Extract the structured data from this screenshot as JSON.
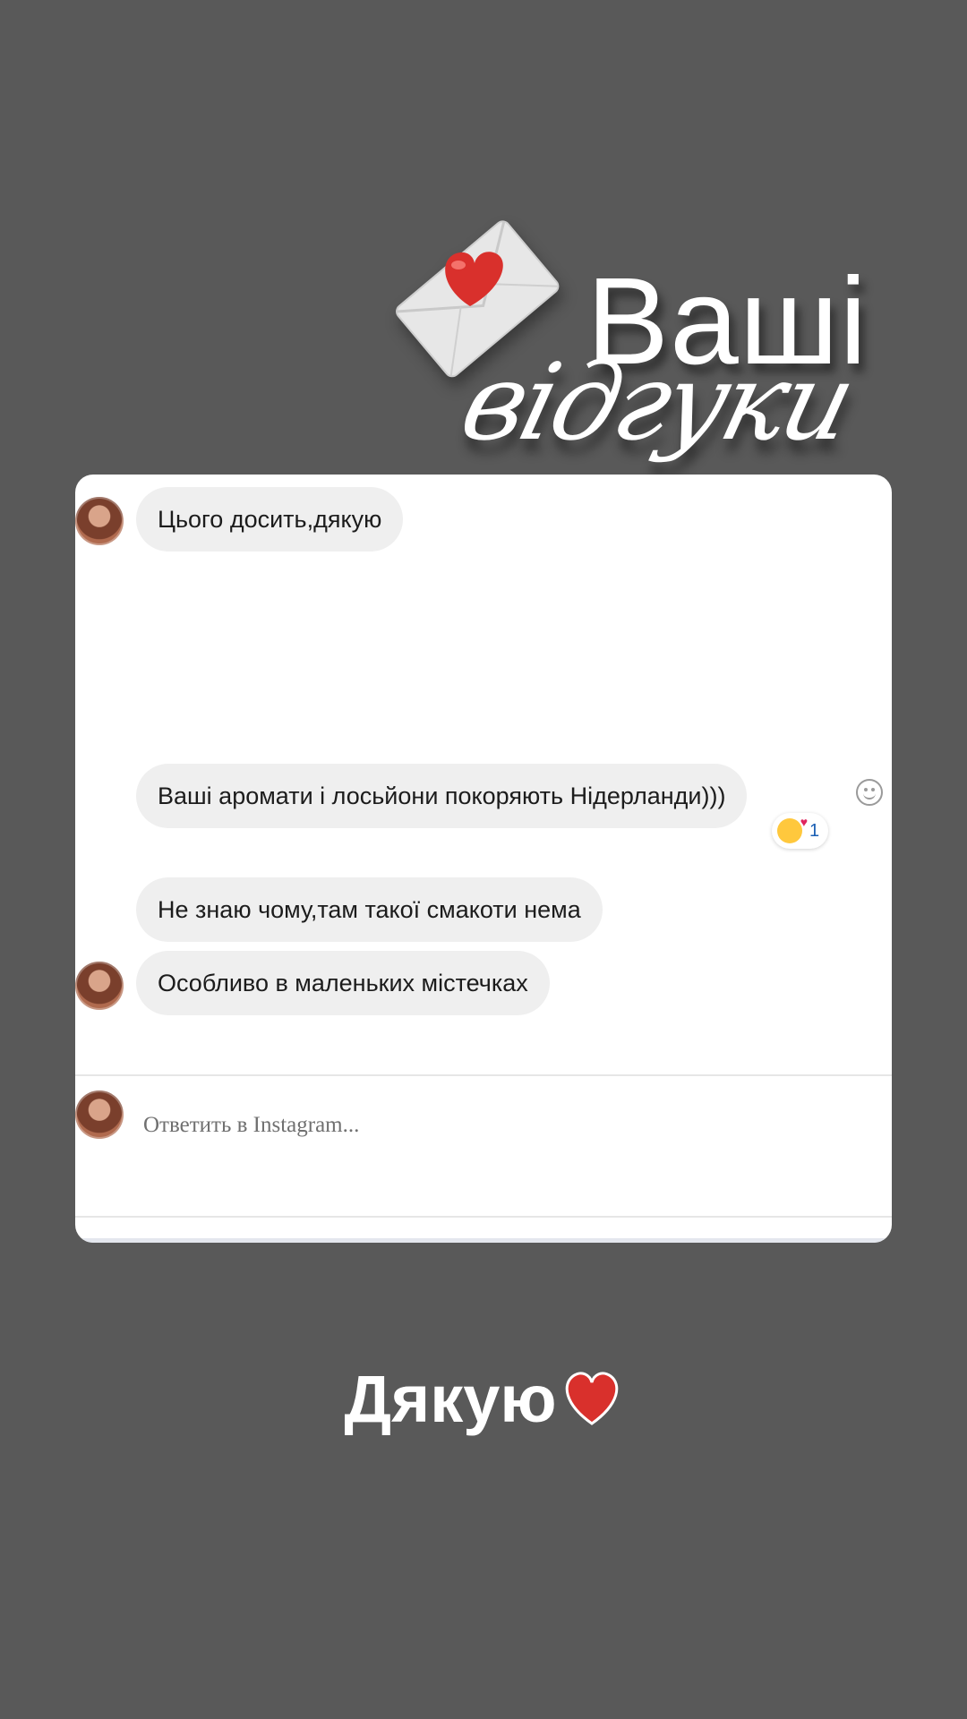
{
  "sticker": {
    "title_line1": "Ваші",
    "title_line2": "відгуки",
    "icon": "envelope-heart-icon"
  },
  "chat": {
    "messages": [
      {
        "text": "Цього досить,дякую"
      },
      {
        "text": "Ваші аромати і лосьйони покоряють Нідерланди)))",
        "reaction_count": "1"
      },
      {
        "text": "Не знаю чому,там такої смакоти нема"
      },
      {
        "text": "Особливо в маленьких містечках"
      }
    ],
    "reply_placeholder": "Ответить в Instagram..."
  },
  "caption": {
    "text": "Дякую",
    "icon": "red-heart-icon"
  },
  "colors": {
    "background": "#595959",
    "card": "#ffffff",
    "bubble": "#efefef",
    "heart": "#d9302c"
  }
}
